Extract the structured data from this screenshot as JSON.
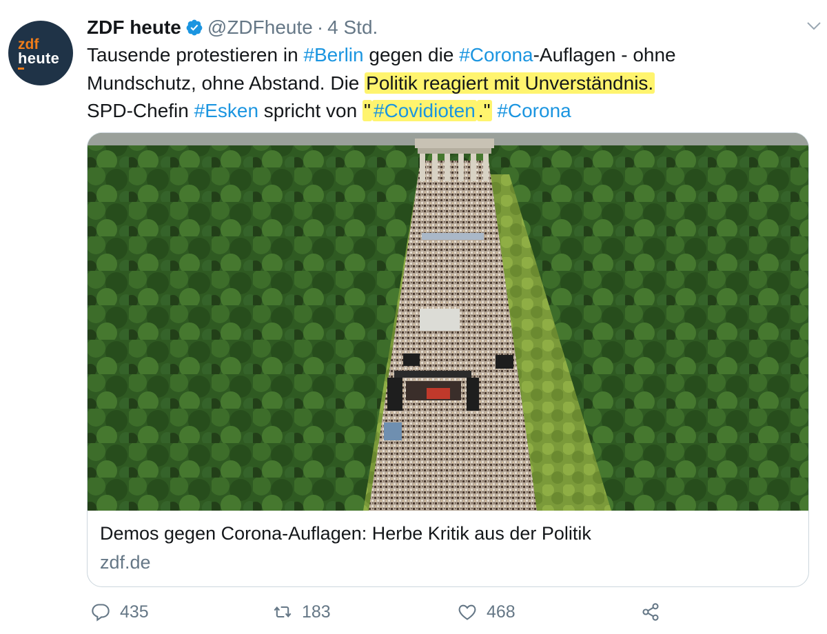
{
  "account": {
    "avatar_logo_top": "zdf",
    "avatar_logo_bottom": "heute",
    "display_name": "ZDF heute",
    "handle": "@ZDFheute",
    "separator": "·",
    "timestamp": "4 Std."
  },
  "tweet": {
    "line1": [
      {
        "text": "Tausende protestieren in ",
        "style": "plain"
      },
      {
        "text": "#Berlin",
        "style": "hashtag"
      },
      {
        "text": " gegen die ",
        "style": "plain"
      },
      {
        "text": "#Corona",
        "style": "hashtag"
      },
      {
        "text": "-Auflagen - ohne",
        "style": "plain"
      }
    ],
    "line2": [
      {
        "text": "Mundschutz, ohne Abstand. Die ",
        "style": "plain"
      },
      {
        "text": "Politik reagiert mit Unverständnis.",
        "style": "highlight"
      }
    ],
    "line3": [
      {
        "text": "SPD-Chefin ",
        "style": "plain"
      },
      {
        "text": "#Esken",
        "style": "hashtag"
      },
      {
        "text": " spricht von ",
        "style": "plain"
      },
      {
        "text": "\"",
        "style": "highlight"
      },
      {
        "text": "#Covidioten",
        "style": "hashtag-highlight"
      },
      {
        "text": ".\"",
        "style": "highlight"
      },
      {
        "text": " ",
        "style": "plain"
      },
      {
        "text": "#Corona",
        "style": "hashtag"
      }
    ]
  },
  "card": {
    "title": "Demos gegen Corona-Auflagen: Herbe Kritik aus der Politik",
    "domain": "zdf.de"
  },
  "actions": {
    "reply_count": "435",
    "retweet_count": "183",
    "like_count": "468"
  },
  "icons": {
    "verified": "verified-badge-icon",
    "menu": "chevron-down-icon",
    "reply": "reply-icon",
    "retweet": "retweet-icon",
    "like": "heart-icon",
    "share": "share-icon"
  },
  "colors": {
    "hashtag": "#1b95e0",
    "highlight": "#fff46e",
    "secondary_text": "#657786",
    "avatar_bg": "#1f3347",
    "avatar_accent": "#f07d1a"
  }
}
